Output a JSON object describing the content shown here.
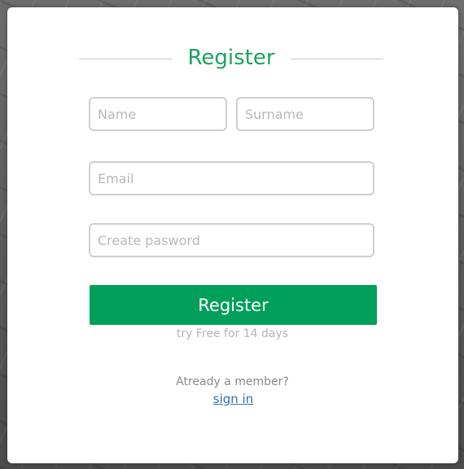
{
  "form": {
    "title": "Register",
    "fields": {
      "name_placeholder": "Name",
      "surname_placeholder": "Surname",
      "email_placeholder": "Email",
      "password_placeholder": "Create pasword"
    },
    "register_button_label": "Register",
    "trial_note": "try Free for 14 days",
    "member_prompt": "Atready a member?",
    "signin_link": "sign in"
  },
  "colors": {
    "accent": "#00a05a",
    "title": "#1aa35f",
    "link": "#2f6fb3"
  }
}
